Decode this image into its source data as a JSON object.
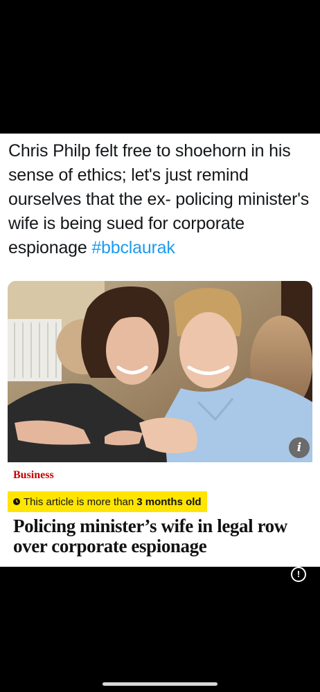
{
  "post": {
    "text": "Chris Philp felt free to shoehorn in his sense of ethics; let's just remind ourselves that the ex- policing minister's wife is being sued for corporate espionage",
    "hashtag": "#bbclaurak"
  },
  "article_card": {
    "photo_icon": "couple-photo",
    "info_badge": "i",
    "section": "Business",
    "age_notice_prefix": "This article is more than",
    "age_notice_bold": "3 months old",
    "headline": "Policing minister’s wife in legal row over corporate espionage",
    "accent_section_color": "#c70000",
    "age_banner_color": "#ffe500"
  },
  "overlay": {
    "alert_icon": "!",
    "home_indicator_icon": "home-indicator"
  },
  "colors": {
    "hashtag": "#1d9bf0",
    "background": "#000000"
  }
}
